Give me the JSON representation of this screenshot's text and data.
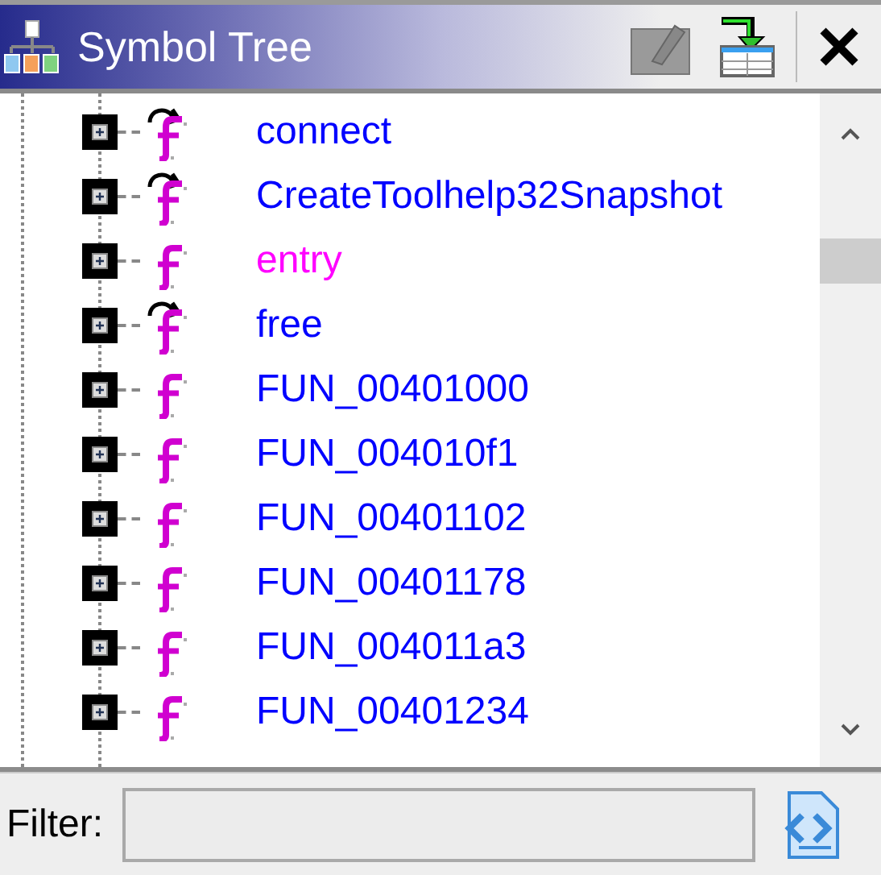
{
  "panel": {
    "title": "Symbol Tree"
  },
  "tree": {
    "items": [
      {
        "label": "connect",
        "kind": "thunk",
        "color": "#0000ff"
      },
      {
        "label": "CreateToolhelp32Snapshot",
        "kind": "thunk",
        "color": "#0000ff"
      },
      {
        "label": "entry",
        "kind": "function",
        "color": "#ff00ff"
      },
      {
        "label": "free",
        "kind": "thunk",
        "color": "#0000ff"
      },
      {
        "label": "FUN_00401000",
        "kind": "function",
        "color": "#0000ff"
      },
      {
        "label": "FUN_004010f1",
        "kind": "function",
        "color": "#0000ff"
      },
      {
        "label": "FUN_00401102",
        "kind": "function",
        "color": "#0000ff"
      },
      {
        "label": "FUN_00401178",
        "kind": "function",
        "color": "#0000ff"
      },
      {
        "label": "FUN_004011a3",
        "kind": "function",
        "color": "#0000ff"
      },
      {
        "label": "FUN_00401234",
        "kind": "function",
        "color": "#0000ff"
      }
    ]
  },
  "filter": {
    "label": "Filter:"
  }
}
